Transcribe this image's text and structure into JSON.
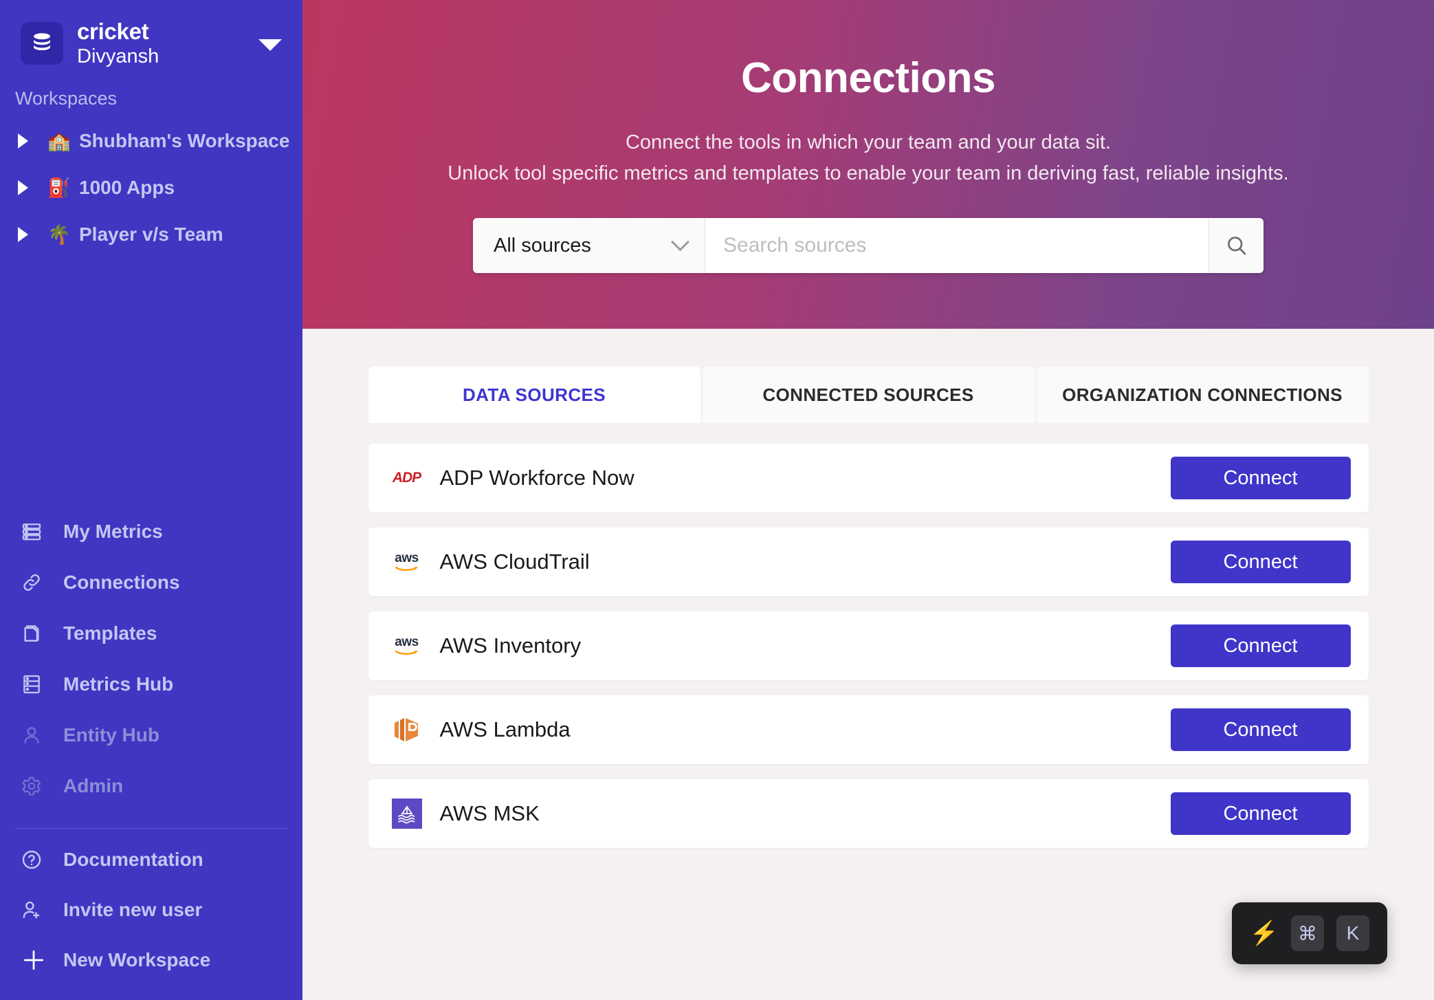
{
  "sidebar": {
    "logo_icon": "database-icon",
    "workspace_name": "cricket",
    "user_name": "Divyansh",
    "dropdown_icon": "caret-down-icon",
    "section_label": "Workspaces",
    "workspaces": [
      {
        "emoji": "🏫",
        "label": "Shubham's Workspace",
        "icon_name": "school-emoji"
      },
      {
        "emoji": "⛽",
        "label": "1000 Apps",
        "icon_name": "fuel-pump-emoji"
      },
      {
        "emoji": "🌴",
        "label": "Player v/s Team",
        "icon_name": "palm-tree-emoji"
      }
    ],
    "nav": [
      {
        "label": "My Metrics",
        "icon": "metrics-list-icon",
        "disabled": false
      },
      {
        "label": "Connections",
        "icon": "link-icon",
        "disabled": false
      },
      {
        "label": "Templates",
        "icon": "document-icon",
        "disabled": false
      },
      {
        "label": "Metrics Hub",
        "icon": "server-icon",
        "disabled": false
      },
      {
        "label": "Entity Hub",
        "icon": "user-icon",
        "disabled": true
      },
      {
        "label": "Admin",
        "icon": "gear-icon",
        "disabled": true
      }
    ],
    "bottom_nav": [
      {
        "label": "Documentation",
        "icon": "question-circle-icon"
      },
      {
        "label": "Invite new user",
        "icon": "user-plus-icon"
      },
      {
        "label": "New Workspace",
        "icon": "plus-icon"
      }
    ]
  },
  "hero": {
    "title": "Connections",
    "subtitle_line1": "Connect the tools in which your team and your data sit.",
    "subtitle_line2": "Unlock tool specific metrics and templates to enable your team in deriving fast, reliable insights.",
    "gradient_start": "#bb3760",
    "gradient_end": "#6e4089"
  },
  "search": {
    "source_filter_value": "All sources",
    "source_filter_icon": "chevron-down-icon",
    "input_value": "",
    "placeholder": "Search sources",
    "search_icon": "search-icon"
  },
  "tabs": [
    {
      "label": "DATA SOURCES",
      "active": true
    },
    {
      "label": "CONNECTED SOURCES",
      "active": false
    },
    {
      "label": "ORGANIZATION CONNECTIONS",
      "active": false
    }
  ],
  "sources": [
    {
      "name": "ADP Workforce Now",
      "logo": "adp-logo",
      "action_label": "Connect"
    },
    {
      "name": "AWS CloudTrail",
      "logo": "aws-logo",
      "action_label": "Connect"
    },
    {
      "name": "AWS Inventory",
      "logo": "aws-logo",
      "action_label": "Connect"
    },
    {
      "name": "AWS Lambda",
      "logo": "aws-lambda-logo",
      "action_label": "Connect"
    },
    {
      "name": "AWS MSK",
      "logo": "aws-msk-logo",
      "action_label": "Connect"
    }
  ],
  "shortcut_widget": {
    "bolt_icon": "lightning-bolt-icon",
    "key1": "⌘",
    "key2": "K"
  },
  "colors": {
    "sidebar_bg": "#4036c2",
    "accent": "#3f35c9",
    "tab_active_text": "#3f35d1",
    "page_bg": "#f5f1f1"
  }
}
